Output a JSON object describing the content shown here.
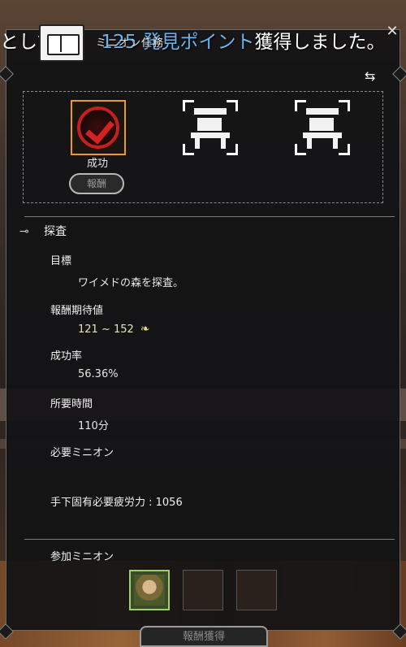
{
  "window": {
    "title": "ミニオン任務",
    "close_symbol": "✕"
  },
  "broadcast": {
    "prefix": "として",
    "highlight": "125 発見ポイント",
    "suffix": "獲得しました。"
  },
  "result": {
    "status_label": "成功",
    "reward_button": "報酬"
  },
  "icons": {
    "refresh": "⇆",
    "section_arrow": "⊸",
    "reward": "❧"
  },
  "mission": {
    "type": "探査",
    "goal_label": "目標",
    "goal_value": "ワイメドの森を探査。",
    "expected_reward_label": "報酬期待値",
    "expected_reward_value": "121 ~ 152",
    "success_rate_label": "成功率",
    "success_rate_value": "56.36%",
    "time_label": "所要時間",
    "time_value": "110分",
    "required_minion_label": "必要ミニオン",
    "fatigue_text": "手下固有必要疲労力 : 1056"
  },
  "participants": {
    "label": "参加ミニオン"
  },
  "footer": {
    "claim_button": "報酬獲得"
  },
  "colors": {
    "success_border": "#e89a2a",
    "check_red": "#d42222",
    "highlight_blue": "#6ab4f0",
    "minion_border": "#9fcf6a"
  }
}
